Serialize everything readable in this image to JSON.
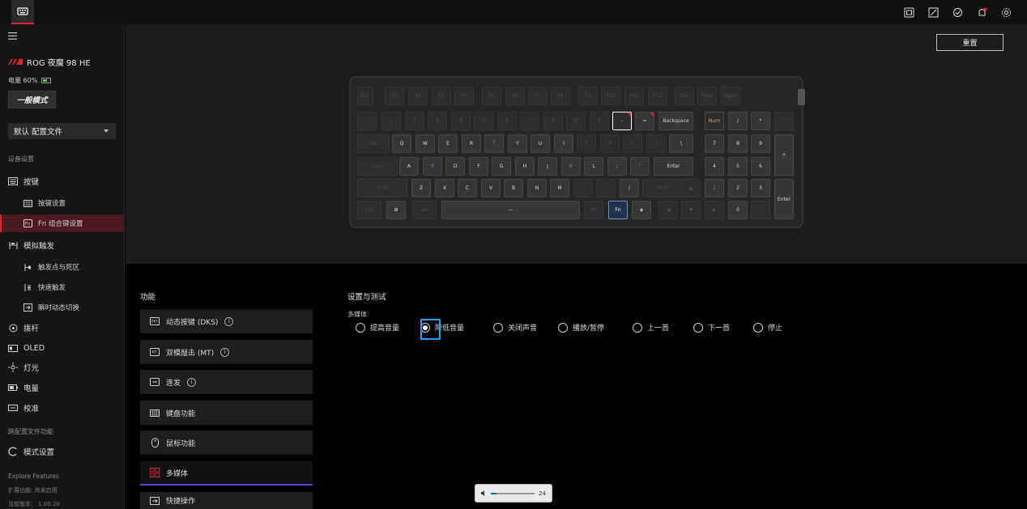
{
  "device": {
    "name": "ROG 夜魔 98 HE",
    "battery_label": "电量 60%",
    "battery_level": 0.6
  },
  "mode_button": "一般模式",
  "profile": {
    "selected": "默认 配置文件"
  },
  "sidebar": {
    "section_device": "设备设置",
    "items": [
      {
        "label": "按键",
        "icon": "keyboard-icon"
      },
      {
        "label": "按键设置",
        "icon": "keygrid-icon"
      },
      {
        "label": "Fn 组合键设置",
        "icon": "fn-icon"
      },
      {
        "label": "模拟触发",
        "icon": "analog-icon"
      },
      {
        "label": "触发点与死区",
        "icon": "trigger-icon"
      },
      {
        "label": "快速触发",
        "icon": "rapid-icon"
      },
      {
        "label": "瞬时动态切换",
        "icon": "switch-icon"
      },
      {
        "label": "拨杆",
        "icon": "dial-icon"
      },
      {
        "label": "OLED",
        "icon": "oled-icon"
      },
      {
        "label": "灯光",
        "icon": "light-icon"
      },
      {
        "label": "电量",
        "icon": "battery-icon"
      },
      {
        "label": "校准",
        "icon": "calibrate-icon"
      }
    ],
    "section_profile": "跨配置文件功能",
    "mode_settings": "模式设置",
    "explore": "Explore Features",
    "footer1": "扩展功能: 尚未启用",
    "footer2": "当前版本： 1.00.20"
  },
  "reset_button": "重置",
  "keyboard": {
    "rows": [
      [
        "Esc",
        "F1",
        "F2",
        "F3",
        "F4",
        "F5",
        "F6",
        "F7",
        "F8",
        "F9",
        "F10",
        "F11",
        "F12",
        "Del",
        "PgUp",
        "PgDn"
      ],
      [
        "`",
        "1",
        "2",
        "3",
        "4",
        "5",
        "6",
        "7",
        "8",
        "9",
        "0",
        "-",
        "=",
        "Backspace",
        "Num",
        "/",
        "*",
        "-"
      ],
      [
        "Tab",
        "Q",
        "W",
        "E",
        "R",
        "T",
        "Y",
        "U",
        "I",
        "O",
        "P",
        "[",
        "]",
        "\\",
        "7",
        "8",
        "9",
        "+"
      ],
      [
        "Caps",
        "A",
        "S",
        "D",
        "F",
        "G",
        "H",
        "J",
        "K",
        "L",
        ";",
        "'",
        "Enter",
        "4",
        "5",
        "6"
      ],
      [
        "Shift",
        "Z",
        "X",
        "C",
        "V",
        "B",
        "N",
        "M",
        ",",
        ".",
        "/",
        "Shift",
        "▲",
        "1",
        "2",
        "3",
        "Enter"
      ],
      [
        "Ctrl",
        "⊞",
        "Alt",
        "—",
        "Alt",
        "Fn",
        "◈",
        "◀",
        "▼",
        "▶",
        "0",
        "."
      ]
    ]
  },
  "functions": {
    "title": "功能",
    "items": [
      {
        "label": "动态按键 (DKS)",
        "info": "i"
      },
      {
        "label": "双模敲击 (MT)",
        "info": "i"
      },
      {
        "label": "连发",
        "info": "i"
      },
      {
        "label": "键盘功能"
      },
      {
        "label": "鼠标功能"
      },
      {
        "label": "多媒体"
      },
      {
        "label": "快捷操作"
      }
    ]
  },
  "settings": {
    "title": "设置与测试",
    "group": "多媒体",
    "options": [
      "提高音量",
      "降低音量",
      "关闭声音",
      "播放/暂停",
      "上一首",
      "下一首",
      "停止"
    ],
    "selected_index": 1
  },
  "volume_popup": {
    "value": "24",
    "level": 0.24
  },
  "colors": {
    "accent_red": "#e0242c",
    "fn_blue": "#6c93c9",
    "focus_blue": "#1ea0ff",
    "tab_purple": "#6b3fd1"
  }
}
